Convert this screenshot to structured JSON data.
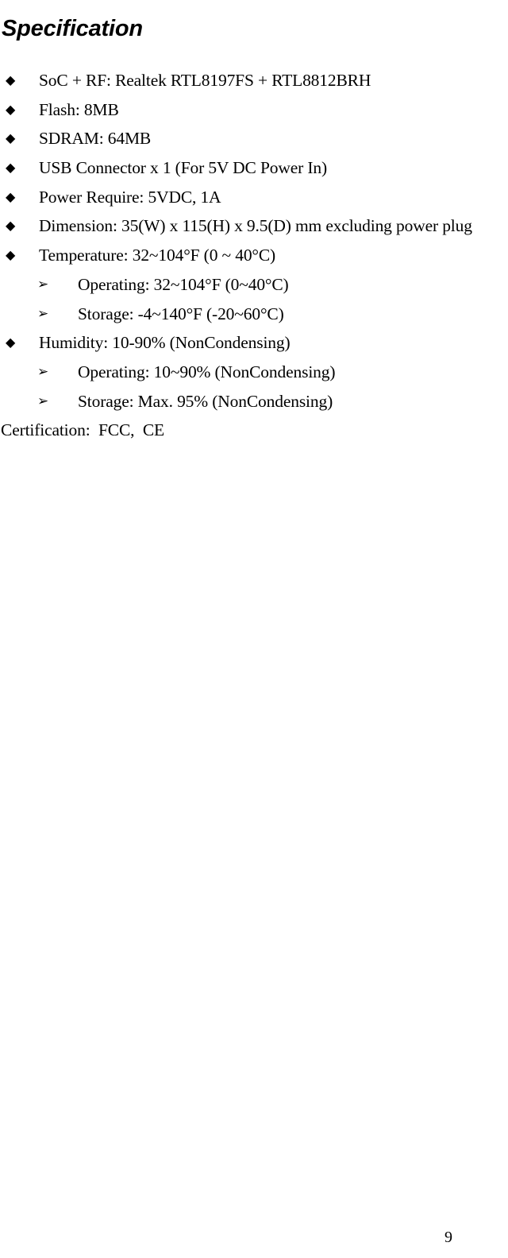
{
  "document": {
    "title": "Specification",
    "page_number": "9"
  },
  "spec_list": [
    {
      "level": 1,
      "bullet": "diamond-bullet",
      "glyph": "◆",
      "text": "SoC + RF: Realtek RTL8197FS + RTL8812BRH"
    },
    {
      "level": 1,
      "bullet": "diamond-bullet",
      "glyph": "◆",
      "text": "Flash: 8MB"
    },
    {
      "level": 1,
      "bullet": "diamond-bullet",
      "glyph": "◆",
      "text": "SDRAM: 64MB"
    },
    {
      "level": 1,
      "bullet": "diamond-bullet",
      "glyph": "◆",
      "text": "USB Connector x 1 (For 5V DC Power In)"
    },
    {
      "level": 1,
      "bullet": "diamond-bullet",
      "glyph": "◆",
      "text": "Power Require: 5VDC, 1A"
    },
    {
      "level": 1,
      "bullet": "diamond-bullet",
      "glyph": "◆",
      "text": "Dimension: 35(W) x 115(H) x 9.5(D) mm excluding power plug"
    },
    {
      "level": 1,
      "bullet": "diamond-bullet",
      "glyph": "◆",
      "text": "Temperature: 32~104°F (0 ~ 40°C)"
    },
    {
      "level": 2,
      "bullet": "arrowhead-bullet",
      "glyph": "➢",
      "text": "Operating: 32~104°F (0~40°C)"
    },
    {
      "level": 2,
      "bullet": "arrowhead-bullet",
      "glyph": "➢",
      "text": "Storage: -4~140°F (-20~60°C)"
    },
    {
      "level": 1,
      "bullet": "diamond-bullet",
      "glyph": "◆",
      "text": "Humidity: 10-90% (NonCondensing)"
    },
    {
      "level": 2,
      "bullet": "arrowhead-bullet",
      "glyph": "➢",
      "text": "Operating: 10~90% (NonCondensing)"
    },
    {
      "level": 2,
      "bullet": "arrowhead-bullet",
      "glyph": "➢",
      "text": "Storage: Max. 95% (NonCondensing)"
    },
    {
      "level": 0,
      "bullet": "none",
      "glyph": "",
      "text": "Certification:  FCC,  CE"
    }
  ]
}
